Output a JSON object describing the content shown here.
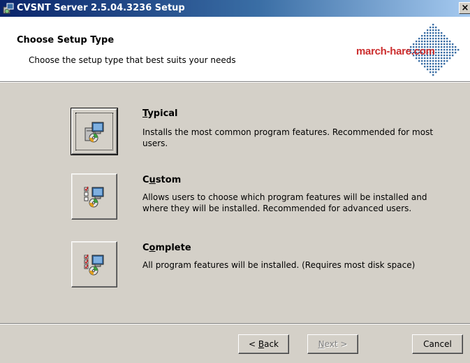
{
  "window": {
    "title": "CVSNT Server 2.5.04.3236 Setup",
    "close_label": "×"
  },
  "banner": {
    "title": "Choose Setup Type",
    "subtitle": "Choose the setup type that best suits your needs",
    "logo_text": "march-hare.com"
  },
  "options": [
    {
      "title": "Typical",
      "description": "Installs the most common program features. Recommended for most users.",
      "icon": "typical-setup-icon"
    },
    {
      "title": "Custom",
      "description": "Allows users to choose which program features will be installed and where they will be installed. Recommended for advanced users.",
      "icon": "custom-setup-icon"
    },
    {
      "title": "Complete",
      "description": "All program features will be installed.  (Requires most disk space)",
      "icon": "complete-setup-icon"
    }
  ],
  "buttons": {
    "back": "< Back",
    "next": "Next >",
    "cancel": "Cancel"
  },
  "colors": {
    "titlebar_start": "#0a246a",
    "titlebar_end": "#a6caf0",
    "logo_red": "#cc2e2e",
    "logo_blue": "#3a6ea5",
    "face": "#d4d0c8"
  }
}
